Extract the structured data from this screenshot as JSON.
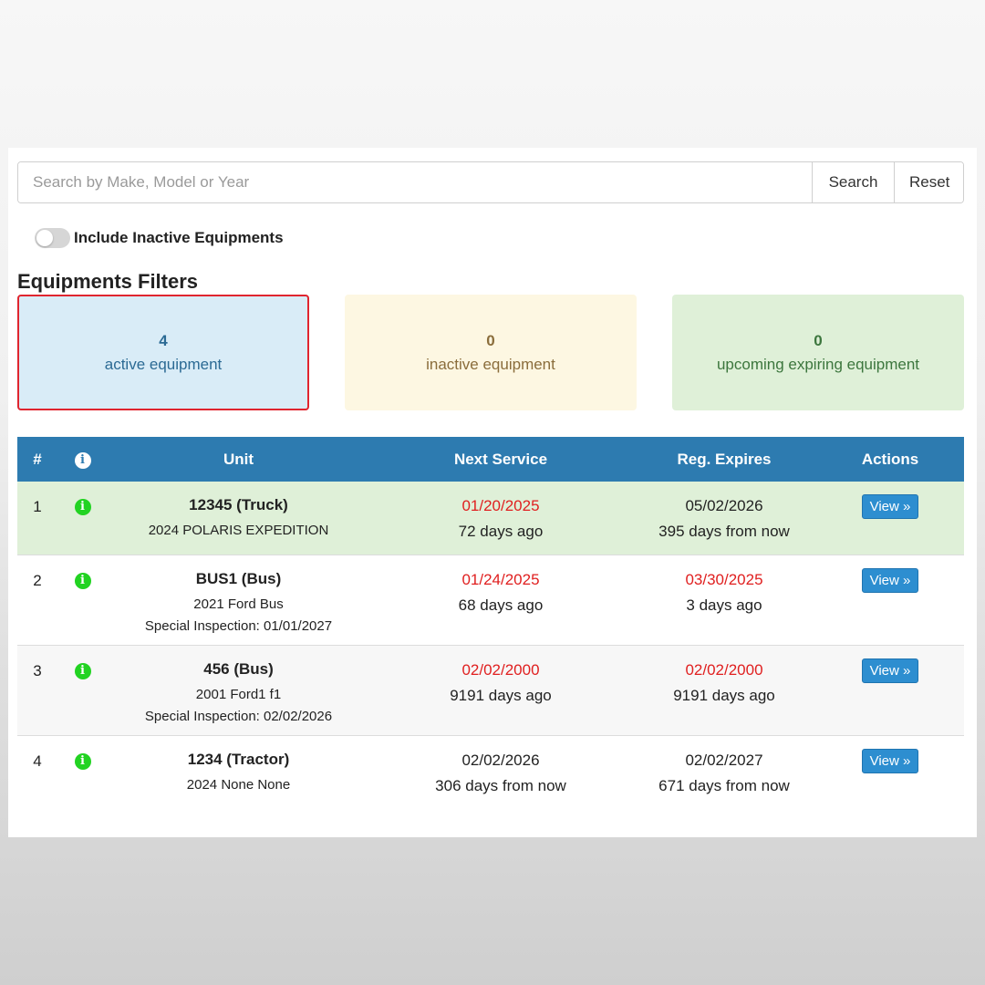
{
  "search": {
    "placeholder": "Search by Make, Model or Year",
    "value": "",
    "search_label": "Search",
    "reset_label": "Reset"
  },
  "toggle": {
    "label": "Include Inactive Equipments",
    "checked": false
  },
  "filters": {
    "title": "Equipments Filters",
    "cards": [
      {
        "count": "4",
        "label": "active equipment",
        "selected": true
      },
      {
        "count": "0",
        "label": "inactive equipment",
        "selected": false
      },
      {
        "count": "0",
        "label": "upcoming expiring equipment",
        "selected": false
      }
    ]
  },
  "table": {
    "headers": {
      "num": "#",
      "info": "info-icon",
      "unit": "Unit",
      "next_service": "Next Service",
      "reg_expires": "Reg. Expires",
      "actions": "Actions"
    },
    "rows": [
      {
        "num": "1",
        "unit_name": "12345 (Truck)",
        "unit_sub": "2024 POLARIS EXPEDITION",
        "special_inspection": "",
        "next_service_date": "01/20/2025",
        "next_service_rel": "72 days ago",
        "next_service_overdue": true,
        "reg_expires_date": "05/02/2026",
        "reg_expires_rel": "395 days from now",
        "reg_expires_overdue": false,
        "view_label": "View »"
      },
      {
        "num": "2",
        "unit_name": "BUS1 (Bus)",
        "unit_sub": "2021 Ford Bus",
        "special_inspection": "Special Inspection: 01/01/2027",
        "next_service_date": "01/24/2025",
        "next_service_rel": "68 days ago",
        "next_service_overdue": true,
        "reg_expires_date": "03/30/2025",
        "reg_expires_rel": "3 days ago",
        "reg_expires_overdue": true,
        "view_label": "View »"
      },
      {
        "num": "3",
        "unit_name": "456 (Bus)",
        "unit_sub": "2001 Ford1 f1",
        "special_inspection": "Special Inspection: 02/02/2026",
        "next_service_date": "02/02/2000",
        "next_service_rel": "9191 days ago",
        "next_service_overdue": true,
        "reg_expires_date": "02/02/2000",
        "reg_expires_rel": "9191 days ago",
        "reg_expires_overdue": true,
        "view_label": "View »"
      },
      {
        "num": "4",
        "unit_name": "1234 (Tractor)",
        "unit_sub": "2024 None None",
        "special_inspection": "",
        "next_service_date": "02/02/2026",
        "next_service_rel": "306 days from now",
        "next_service_overdue": false,
        "reg_expires_date": "02/02/2027",
        "reg_expires_rel": "671 days from now",
        "reg_expires_overdue": false,
        "view_label": "View »"
      }
    ]
  },
  "colors": {
    "header_blue": "#2d7bb0",
    "overdue_red": "#e01f1f",
    "info_green": "#22d322",
    "active_card_bg": "#d9ecf7",
    "inactive_card_bg": "#fdf7e2",
    "expiring_card_bg": "#dff0d8",
    "selected_border": "#e0252f"
  }
}
